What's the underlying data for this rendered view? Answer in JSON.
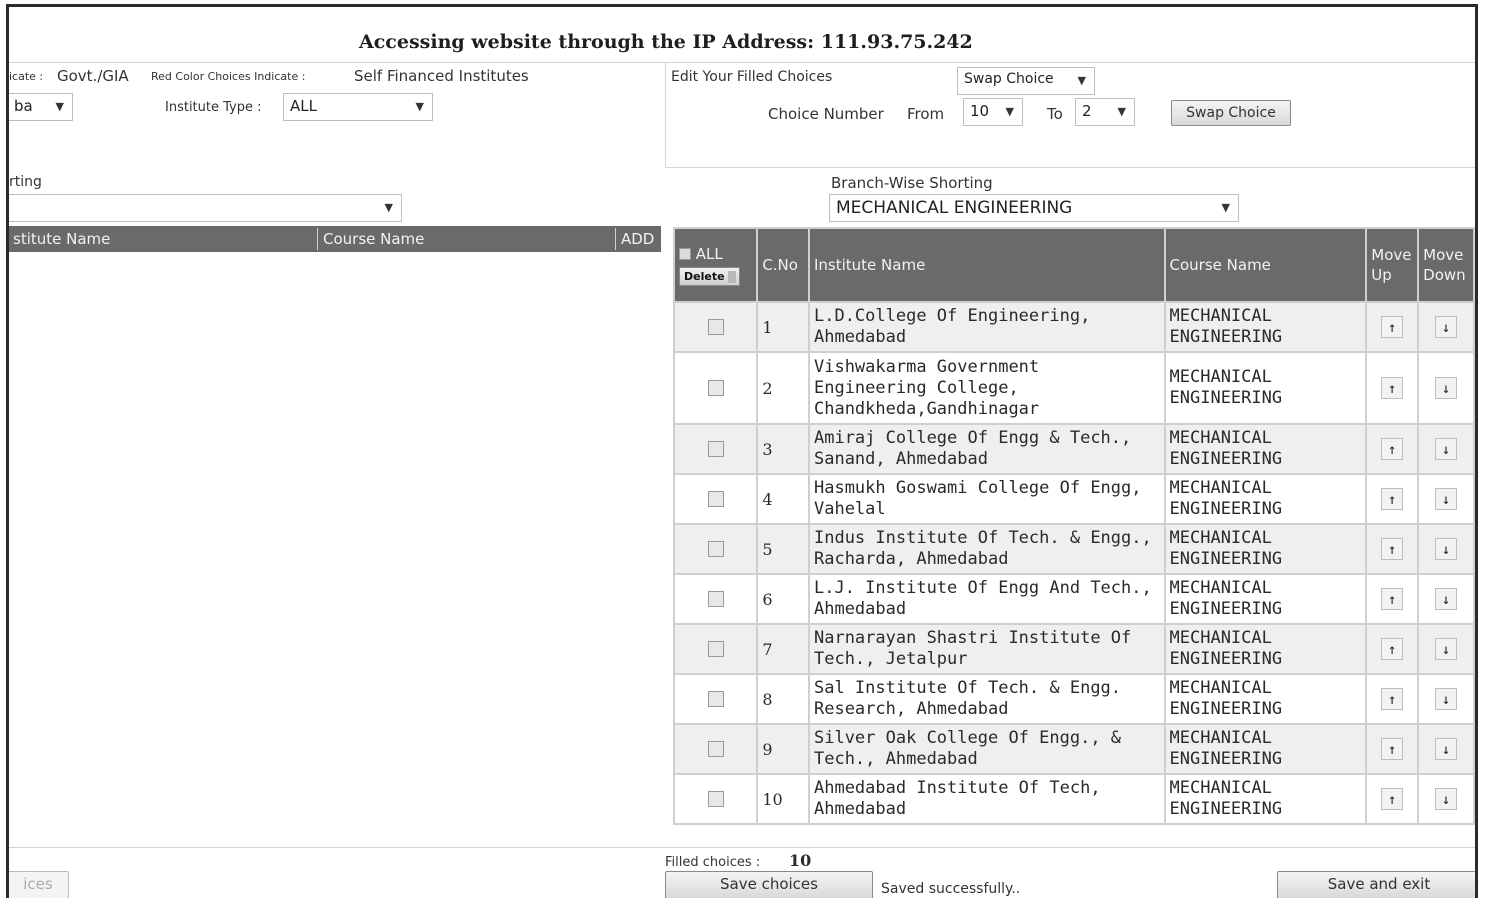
{
  "header": {
    "title": "Accessing website through the IP Address: 111.93.75.242"
  },
  "legend": {
    "govt_prefix": "icate :",
    "govt_text": "Govt./GIA",
    "red_prefix": "Red Color Choices Indicate :",
    "self_text": "Self Financed Institutes"
  },
  "left_filters": {
    "city_select": "ba",
    "institute_type_label": "Institute Type :",
    "institute_type_value": "ALL",
    "sorting_label": "rting",
    "sorting_value": ""
  },
  "left_table": {
    "col_institute": "stitute Name",
    "col_course": "Course Name",
    "col_add": "ADD"
  },
  "edit": {
    "label": "Edit Your Filled Choices",
    "mode_value": "Swap Choice",
    "choice_number_label": "Choice Number",
    "from_label": "From",
    "from_value": "10",
    "to_label": "To",
    "to_value": "2",
    "swap_button": "Swap Choice"
  },
  "branch": {
    "label": "Branch-Wise Shorting",
    "value": "MECHANICAL ENGINEERING"
  },
  "grid": {
    "all_label": "ALL",
    "delete_label": "Delete",
    "col_cno": "C.No",
    "col_institute": "Institute Name",
    "col_course": "Course Name",
    "col_move_up": "Move Up",
    "col_move_down": "Move Down",
    "rows": [
      {
        "no": "1",
        "institute": "L.D.College Of Engineering, Ahmedabad",
        "course": "MECHANICAL ENGINEERING"
      },
      {
        "no": "2",
        "institute": "Vishwakarma Government Engineering College, Chandkheda,Gandhinagar",
        "course": "MECHANICAL ENGINEERING"
      },
      {
        "no": "3",
        "institute": "Amiraj College Of Engg & Tech., Sanand, Ahmedabad",
        "course": "MECHANICAL ENGINEERING"
      },
      {
        "no": "4",
        "institute": "Hasmukh Goswami College Of Engg, Vahelal",
        "course": "MECHANICAL ENGINEERING"
      },
      {
        "no": "5",
        "institute": "Indus Institute Of Tech. & Engg., Racharda, Ahmedabad",
        "course": "MECHANICAL ENGINEERING"
      },
      {
        "no": "6",
        "institute": "L.J. Institute Of Engg And Tech., Ahmedabad",
        "course": "MECHANICAL ENGINEERING"
      },
      {
        "no": "7",
        "institute": "Narnarayan Shastri Institute Of Tech., Jetalpur",
        "course": "MECHANICAL ENGINEERING"
      },
      {
        "no": "8",
        "institute": "Sal Institute Of Tech. & Engg. Research, Ahmedabad",
        "course": "MECHANICAL ENGINEERING"
      },
      {
        "no": "9",
        "institute": "Silver Oak College Of Engg., & Tech., Ahmedabad",
        "course": "MECHANICAL ENGINEERING"
      },
      {
        "no": "10",
        "institute": "Ahmedabad Institute Of Tech, Ahmedabad",
        "course": "MECHANICAL ENGINEERING"
      }
    ]
  },
  "footer": {
    "filled_label": "Filled choices :",
    "filled_count": "10",
    "left_button": "ices",
    "save_button": "Save choices",
    "status": "Saved successfully..",
    "save_exit_button": "Save and exit"
  },
  "icons": {
    "up": "up-arrow-icon",
    "down": "down-arrow-icon",
    "caret": "chevron-down-icon"
  }
}
